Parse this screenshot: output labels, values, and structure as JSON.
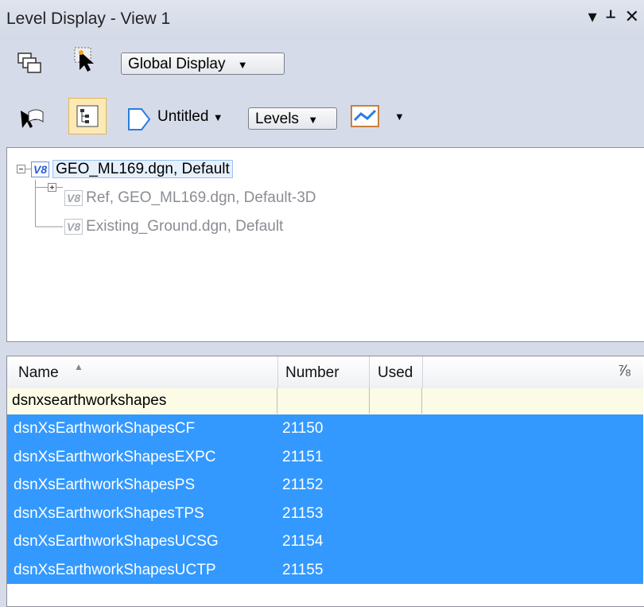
{
  "window": {
    "title": "Level Display - View 1",
    "controls": [
      "▾",
      "ᚆ",
      "✕"
    ]
  },
  "toolbar1": {
    "display_mode": "Global Display"
  },
  "toolbar2": {
    "view_name": "Untitled",
    "mode": "Levels"
  },
  "tree": {
    "root": "GEO_ML169.dgn, Default",
    "children": [
      "Ref, GEO_ML169.dgn, Default-3D",
      "Existing_Ground.dgn, Default"
    ],
    "badge": "V8"
  },
  "list": {
    "columns": {
      "name": "Name",
      "number": "Number",
      "used": "Used"
    },
    "filter_text": "dsnxsearthworkshapes",
    "rows": [
      {
        "name": "dsnXsEarthworkShapesCF",
        "number": "21150"
      },
      {
        "name": "dsnXsEarthworkShapesEXPC",
        "number": "21151"
      },
      {
        "name": "dsnXsEarthworkShapesPS",
        "number": "21152"
      },
      {
        "name": "dsnXsEarthworkShapesTPS",
        "number": "21153"
      },
      {
        "name": "dsnXsEarthworkShapesUCSG",
        "number": "21154"
      },
      {
        "name": "dsnXsEarthworkShapesUCTP",
        "number": "21155"
      }
    ]
  }
}
